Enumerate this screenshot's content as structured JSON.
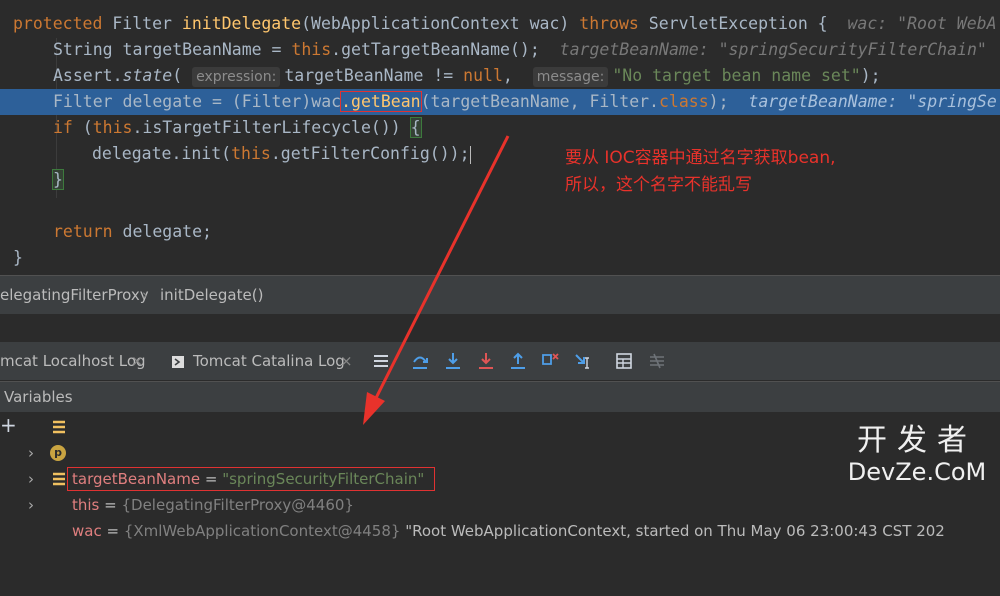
{
  "editor": {
    "l1": {
      "kw": "protected",
      "type": "Filter",
      "fn": "initDelegate",
      "p1": "(WebApplicationContext wac) ",
      "throws": "throws",
      "p2": " ServletException {",
      "hint": "wac: \"Root WebA"
    },
    "l2": {
      "a": "String targetBeanName = ",
      "this": "this",
      "b": ".getTargetBeanName();",
      "hint": "targetBeanName: \"springSecurityFilterChain\""
    },
    "l3": {
      "a": "Assert.",
      "state": "state",
      "b": "(",
      "p_expr": "expression:",
      "c": "targetBeanName != ",
      "null": "null",
      "d": ",",
      "p_msg": "message:",
      "str": "\"No target bean name set\"",
      "e": ");"
    },
    "l4": {
      "a": "Filter delegate = (Filter)wac",
      "box": ".getBean",
      "b": "(targetBeanName, Filter.",
      "class": "class",
      "c": ");",
      "hint": "targetBeanName: \"springSe"
    },
    "l5": {
      "if": "if",
      "a": " (",
      "this": "this",
      "b": ".isTargetFilterLifecycle()) ",
      "brace": "{"
    },
    "l6": {
      "a": "delegate.init(",
      "this": "this",
      "b": ".getFilterConfig());"
    },
    "l7": {
      "brace": "}"
    },
    "l8": {
      "ret": "return",
      "a": " delegate;"
    },
    "l9": {
      "brace": "}"
    }
  },
  "annotation": {
    "line1": "要从 IOC容器中通过名字获取bean,",
    "line2": "所以，这个名字不能乱写"
  },
  "breadcrumb": {
    "class": "elegatingFilterProxy",
    "sep": "›",
    "method": "initDelegate()"
  },
  "tabs": [
    {
      "label": "mcat Localhost Log",
      "close": "×"
    },
    {
      "label": "Tomcat Catalina Log",
      "close": "×"
    }
  ],
  "variables": {
    "header": "Variables",
    "rows": [
      {
        "name": "this",
        "eq": " = ",
        "value": "{DelegatingFilterProxy@4460}"
      },
      {
        "badge": "p",
        "name": "wac",
        "eq": " = ",
        "value": "{XmlWebApplicationContext@4458}",
        "text": " \"Root WebApplicationContext, started on Thu May 06 23:00:43 CST 202"
      },
      {
        "name": "targetBeanName",
        "eq": " = ",
        "value": "\"springSecurityFilterChain\""
      }
    ]
  },
  "watermark": {
    "line1": "开发者",
    "line2": "DevZe.CoM"
  },
  "colors": {
    "accent_red": "#e8322b",
    "selection": "#2d6099",
    "keyword": "#cc7832",
    "string": "#6a8759"
  }
}
